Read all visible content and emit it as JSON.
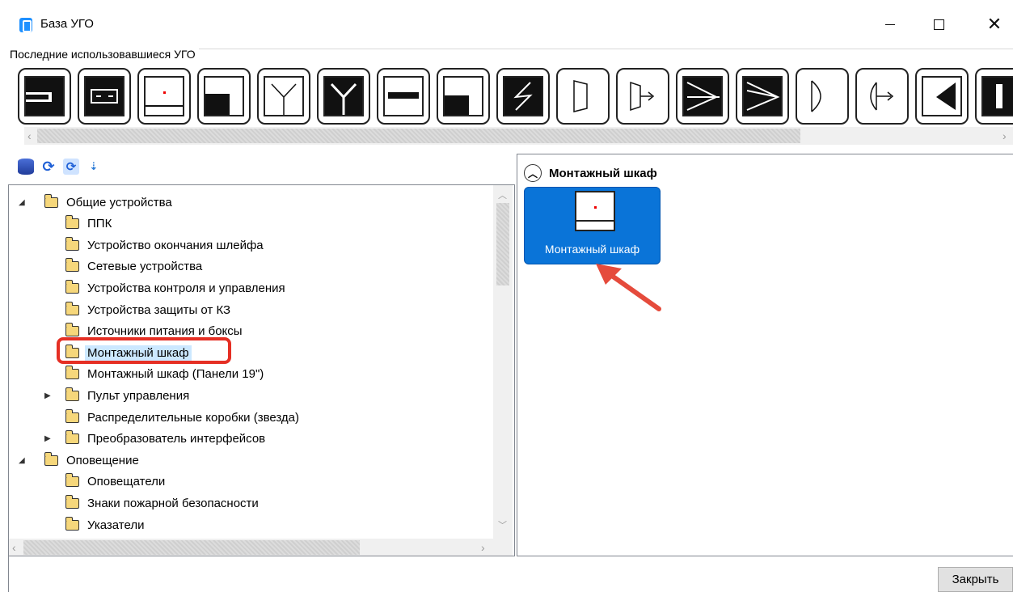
{
  "window": {
    "title": "База УГО",
    "minimize_glyph": "",
    "maximize_glyph": "",
    "close_glyph": "✕"
  },
  "recent": {
    "label": "Последние использовавшиеся УГО",
    "scroll_left": "‹",
    "scroll_right": "›"
  },
  "toolbar": {
    "icons": [
      "database-icon",
      "refresh-icon",
      "refresh-image-icon",
      "sort-icon"
    ]
  },
  "tree": {
    "items": [
      {
        "label": "Общие устройства",
        "level": 0,
        "expander": "◢"
      },
      {
        "label": "ППК",
        "level": 1
      },
      {
        "label": "Устройство окончания шлейфа",
        "level": 1
      },
      {
        "label": "Сетевые устройства",
        "level": 1
      },
      {
        "label": "Устройства контроля и управления",
        "level": 1
      },
      {
        "label": "Устройства защиты от КЗ",
        "level": 1
      },
      {
        "label": "Источники питания и боксы",
        "level": 1
      },
      {
        "label": "Монтажный шкаф",
        "level": 1,
        "selected": true
      },
      {
        "label": "Монтажный шкаф (Панели 19\")",
        "level": 1
      },
      {
        "label": "Пульт управления",
        "level": 1,
        "expander": "▶"
      },
      {
        "label": "Распределительные коробки (звезда)",
        "level": 1
      },
      {
        "label": "Преобразователь интерфейсов",
        "level": 1,
        "expander": "▶"
      },
      {
        "label": "Оповещение",
        "level": 0,
        "expander": "◢"
      },
      {
        "label": "Оповещатели",
        "level": 1
      },
      {
        "label": "Знаки пожарной безопасности",
        "level": 1
      },
      {
        "label": "Указатели",
        "level": 1
      }
    ],
    "scroll_up": "︿",
    "scroll_down": "﹀",
    "scroll_left": "‹",
    "scroll_right": "›"
  },
  "gallery": {
    "group_title": "Монтажный шкаф",
    "collapse_glyph": "︿",
    "item_label": "Монтажный шкаф"
  },
  "footer": {
    "close_label": "Закрыть"
  },
  "colors": {
    "accent": "#0a74d8",
    "highlight": "#e52f24",
    "selection": "#cce8ff"
  }
}
